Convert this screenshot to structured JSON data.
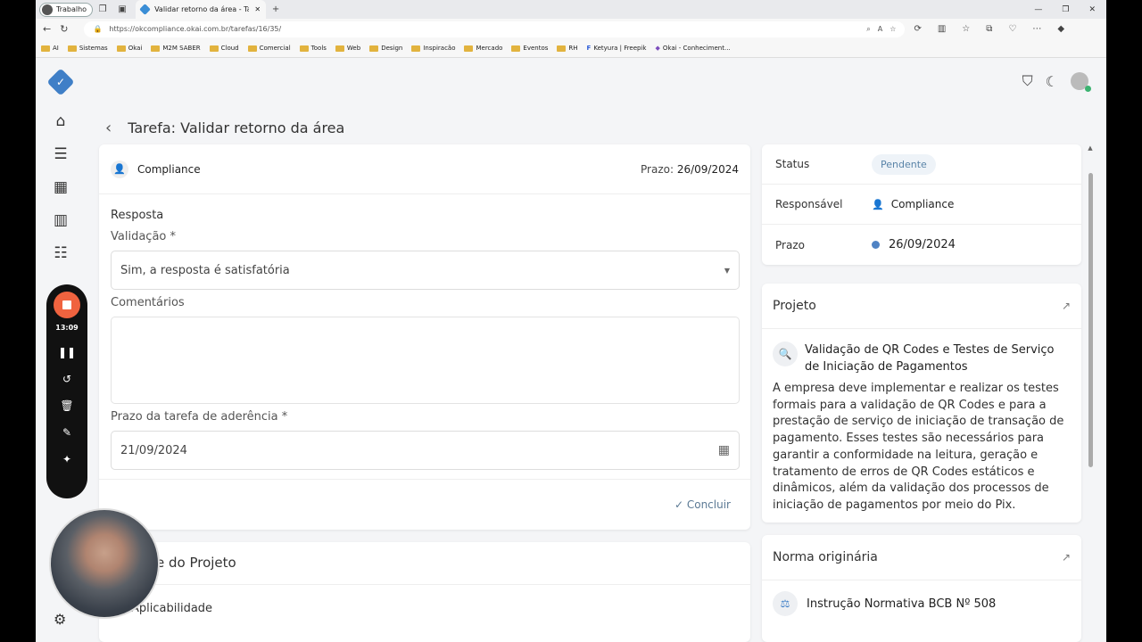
{
  "browser": {
    "profile": "Trabalho",
    "tab_title": "Validar retorno da área - Tarefas",
    "url": "https://okcompliance.okai.com.br/tarefas/16/35/",
    "bookmarks": [
      "AI",
      "Sistemas",
      "Okai",
      "M2M SABER",
      "Cloud",
      "Comercial",
      "Tools",
      "Web",
      "Design",
      "Inspiracão",
      "Mercado",
      "Eventos",
      "RH",
      "Ketyura | Freepik",
      "Okai - Conheciment..."
    ]
  },
  "page": {
    "title": "Tarefa: Validar retorno da área"
  },
  "recorder": {
    "time": "13:09"
  },
  "task": {
    "area": "Compliance",
    "prazo_label": "Prazo:",
    "prazo_value": "26/09/2024",
    "resposta_label": "Resposta",
    "validacao_label": "Validação *",
    "validacao_value": "Sim, a resposta é satisfatória",
    "comentarios_label": "Comentários",
    "prazo_aderencia_label": "Prazo da tarefa de aderência *",
    "prazo_aderencia_value": "21/09/2024",
    "concluir_label": "Concluir"
  },
  "sub_card": {
    "title": "e do Projeto",
    "item": "Aplicabilidade"
  },
  "status_panel": {
    "status_label": "Status",
    "status_value": "Pendente",
    "responsavel_label": "Responsável",
    "responsavel_value": "Compliance",
    "prazo_label": "Prazo",
    "prazo_value": "26/09/2024"
  },
  "projeto": {
    "header": "Projeto",
    "title": "Validação de QR Codes e Testes de Serviço de Iniciação de Pagamentos",
    "description": "A empresa deve implementar e realizar os testes formais para a validação de QR Codes e para a prestação de serviço de iniciação de transação de pagamento. Esses testes são necessários para garantir a conformidade na leitura, geração e tratamento de erros de QR Codes estáticos e dinâmicos, além da validação dos processos de iniciação de pagamentos por meio do Pix."
  },
  "norma": {
    "header": "Norma originária",
    "item": "Instrução Normativa BCB Nº 508"
  }
}
